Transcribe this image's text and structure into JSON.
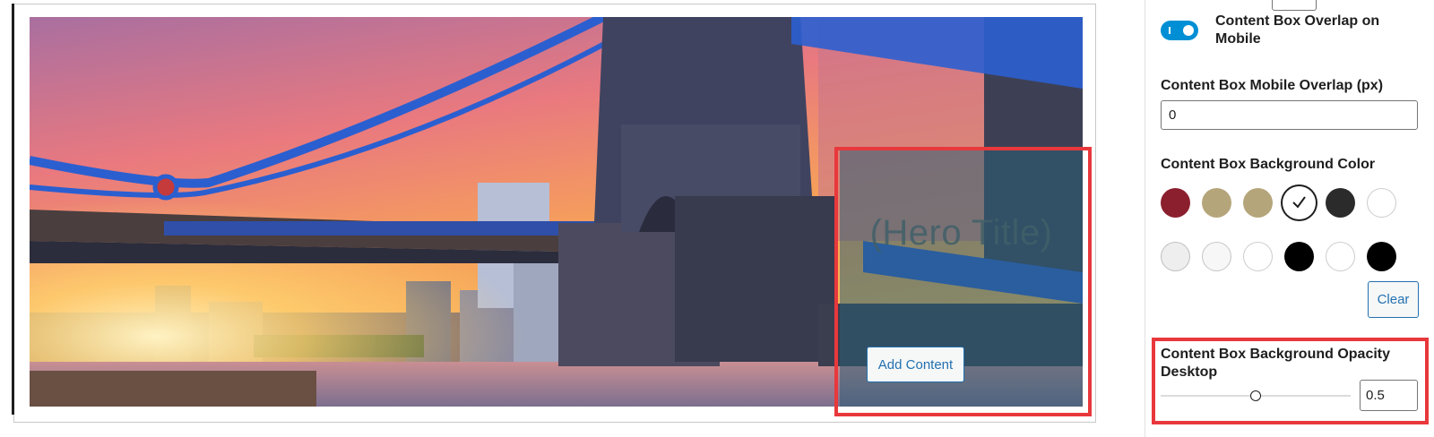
{
  "editor": {
    "hero": {
      "image": "tower-bridge-sunset-photo",
      "title": "(Hero Title)",
      "add_content_label": "Add Content",
      "overlay_color": "#2a5d74"
    }
  },
  "sidebar": {
    "overlap_toggle": {
      "label": "Content Box Overlap on Mobile",
      "checked": true,
      "color": "#008fd4"
    },
    "mobile_overlap": {
      "label": "Content Box Mobile Overlap (px)",
      "value": "0"
    },
    "background_color": {
      "label": "Content Box Background Color",
      "swatches": [
        {
          "color": "#8b1f2e",
          "selected": false
        },
        {
          "color": "#b5a57a",
          "selected": false
        },
        {
          "color": "#b5a57a",
          "selected": false
        },
        {
          "color": "#ffffff",
          "selected": true
        },
        {
          "color": "#2b2b2b",
          "selected": false
        },
        {
          "color": "#ffffff",
          "selected": false
        },
        {
          "color": "#eeeeee",
          "selected": false
        },
        {
          "color": "#f7f7f7",
          "selected": false
        },
        {
          "color": "#ffffff",
          "selected": false
        },
        {
          "color": "#000000",
          "selected": false
        },
        {
          "color": "#ffffff",
          "selected": false
        },
        {
          "color": "#000000",
          "selected": false
        }
      ],
      "clear_label": "Clear"
    },
    "opacity_desktop": {
      "label": "Content Box Background Opacity Desktop",
      "value": "0.5",
      "fraction": 0.5
    }
  },
  "highlight_color": "#e8383c"
}
